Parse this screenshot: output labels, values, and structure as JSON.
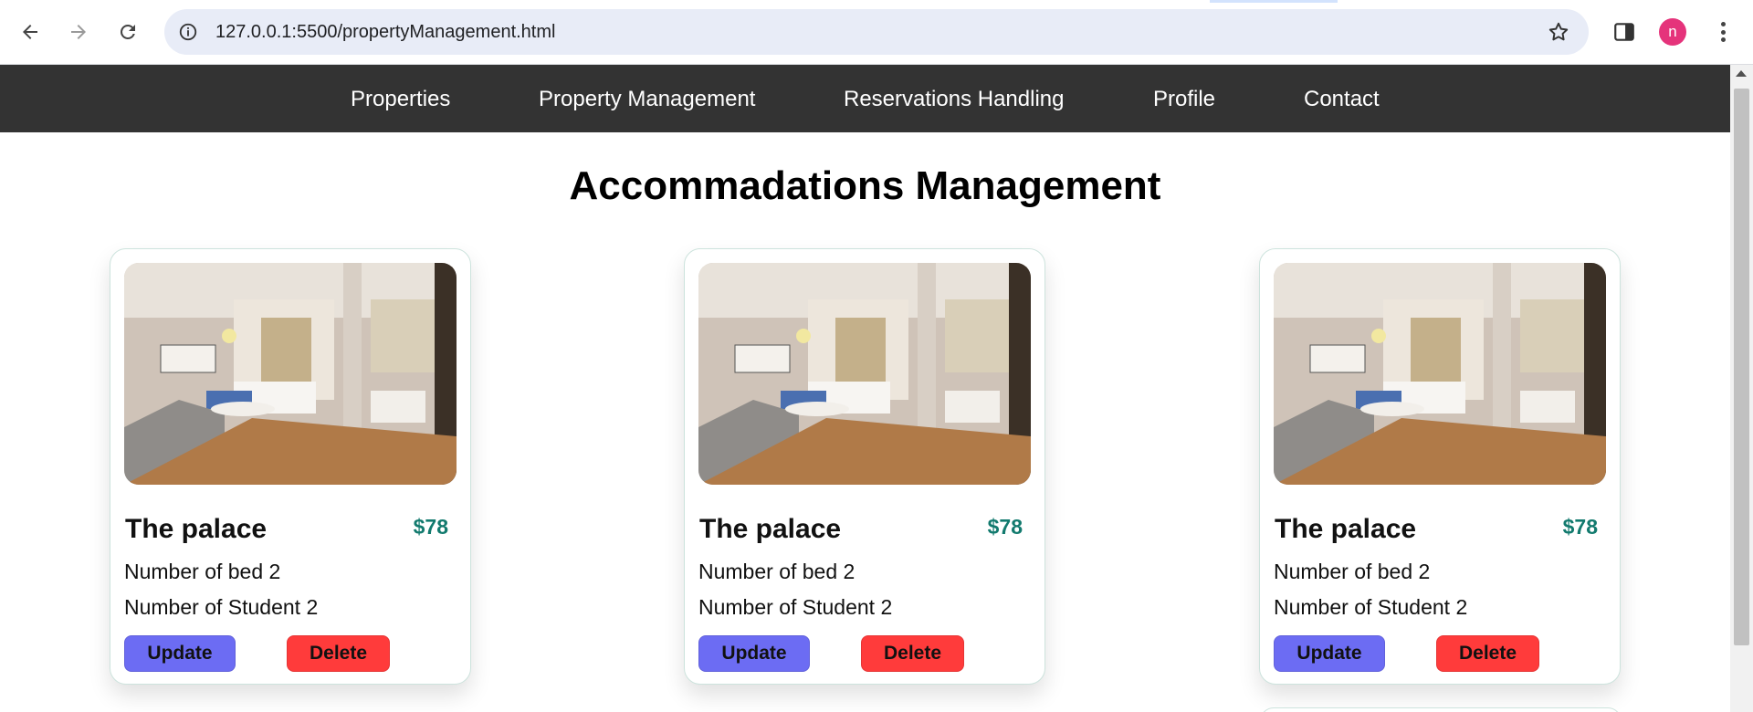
{
  "browser": {
    "url": "127.0.0.1:5500/propertyManagement.html",
    "profile_initial": "n",
    "icons": [
      "back-arrow-icon",
      "forward-arrow-icon",
      "reload-icon",
      "site-info-icon",
      "bookmark-star-icon",
      "side-panel-icon",
      "kebab-menu-icon"
    ]
  },
  "navbar": {
    "items": [
      {
        "label": "Properties"
      },
      {
        "label": "Property Management"
      },
      {
        "label": "Reservations Handling"
      },
      {
        "label": "Profile"
      },
      {
        "label": "Contact"
      }
    ]
  },
  "page": {
    "title": "Accommadations Management"
  },
  "cards": [
    {
      "name": "The palace",
      "price": "$78",
      "beds": "Number of bed 2",
      "students": "Number of Student 2",
      "update_label": "Update",
      "delete_label": "Delete"
    },
    {
      "name": "The palace",
      "price": "$78",
      "beds": "Number of bed 2",
      "students": "Number of Student 2",
      "update_label": "Update",
      "delete_label": "Delete"
    },
    {
      "name": "The palace",
      "price": "$78",
      "beds": "Number of bed 2",
      "students": "Number of Student 2",
      "update_label": "Update",
      "delete_label": "Delete"
    }
  ],
  "colors": {
    "navbar_bg": "#333333",
    "price": "#127a6e",
    "update_button": "#6c6cf3",
    "delete_button": "#ff3b3b",
    "avatar": "#e5337b"
  }
}
